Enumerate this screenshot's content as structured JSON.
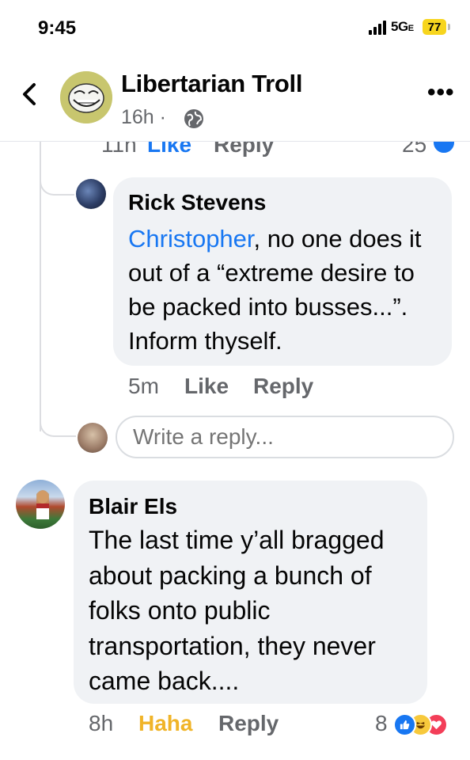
{
  "status_bar": {
    "time": "9:45",
    "network": "5G",
    "network_suffix": "E",
    "battery": "77"
  },
  "header": {
    "back_icon": "chevron-left-icon",
    "page_name": "Libertarian Troll",
    "post_age": "16h ·",
    "audience_icon": "globe-icon",
    "more_label": "•••"
  },
  "previous_reply_partial": {
    "time": "11h",
    "like_label": "Like",
    "reply_label": "Reply",
    "reaction_count": "25"
  },
  "thread_reply": {
    "author": "Rick Stevens",
    "mention": "Christopher",
    "text": ", no one does it out of a “extreme desire to be packed into busses...”. Inform thyself.",
    "time": "5m",
    "like_label": "Like",
    "reply_label": "Reply"
  },
  "reply_box": {
    "placeholder": "Write a reply..."
  },
  "comment": {
    "author": "Blair Els",
    "text": "The last time y’all bragged about packing a bunch of folks onto public transportation, they never came back....",
    "time": "8h",
    "reaction_label": "Haha",
    "reply_label": "Reply",
    "reaction_count": "8",
    "reaction_icons": [
      "like-icon",
      "haha-icon",
      "love-icon"
    ]
  },
  "colors": {
    "facebook_blue": "#1877f2",
    "haha_yellow": "#f0b428",
    "bubble_gray": "#f0f2f5",
    "meta_gray": "#65676b"
  }
}
